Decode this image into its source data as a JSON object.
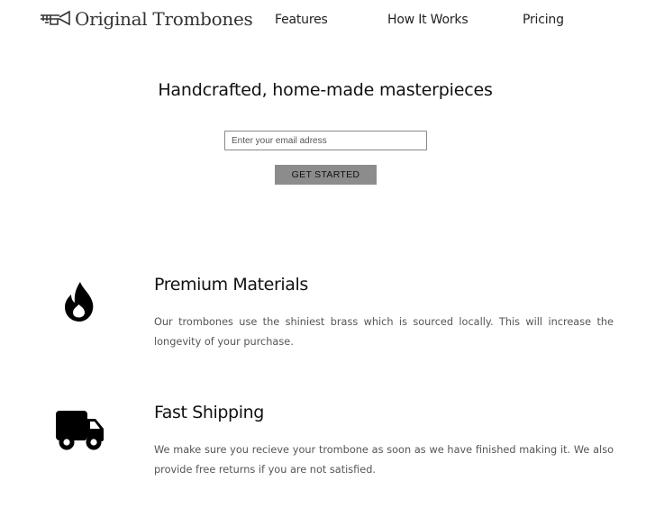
{
  "header": {
    "logo_text": "Original Trombones",
    "logo_icon": "trombone-icon",
    "nav": [
      {
        "label": "Features"
      },
      {
        "label": "How It Works"
      },
      {
        "label": "Pricing"
      }
    ]
  },
  "hero": {
    "title": "Handcrafted, home-made masterpieces",
    "email_placeholder": "Enter your email adress",
    "email_value": "",
    "cta_label": "GET STARTED"
  },
  "features": [
    {
      "icon": "fire-icon",
      "title": "Premium Materials",
      "description": "Our trombones use the shiniest brass which is sourced locally. This will increase the longevity of your purchase."
    },
    {
      "icon": "truck-icon",
      "title": "Fast Shipping",
      "description": "We make sure you recieve your trombone as soon as we have finished making it. We also provide free returns if you are not satisfied."
    }
  ],
  "colors": {
    "background": "#ffffff",
    "button": "#8c8c8c",
    "text": "#222222",
    "muted_text": "#555555"
  }
}
